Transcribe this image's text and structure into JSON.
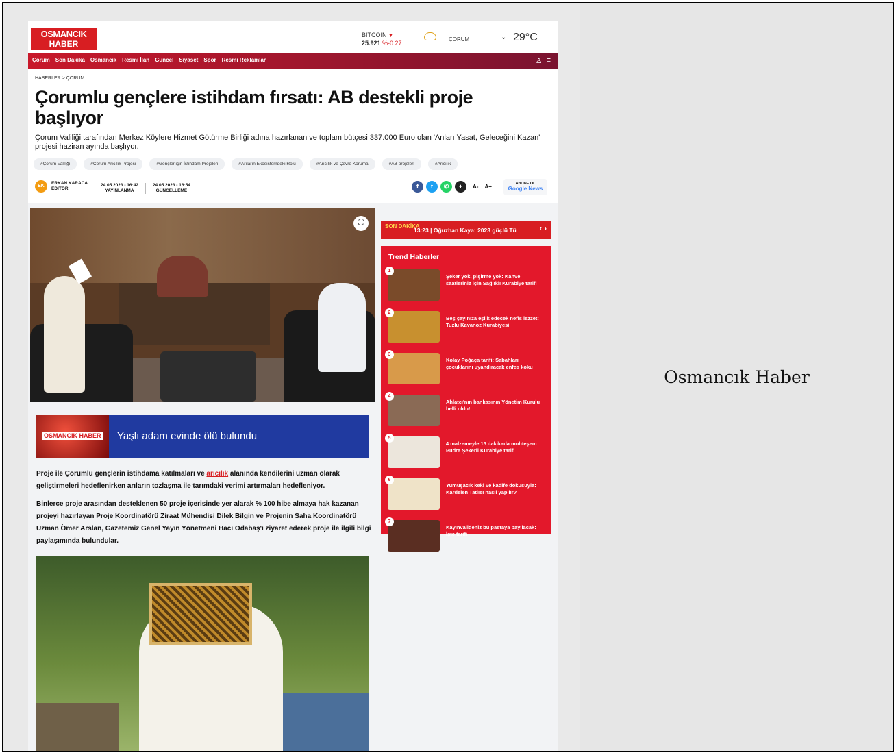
{
  "caption": "Osmancık Haber",
  "site": {
    "logo_line1": "OSMANCIK",
    "logo_line2": "HABER",
    "ticker_name": "BITCOIN",
    "ticker_value": "25.921",
    "ticker_change": "%-0.27",
    "weather_city": "ÇORUM",
    "weather_temp": "29°C"
  },
  "nav": {
    "items": [
      "Çorum",
      "Son Dakika",
      "Osmancık",
      "Resmi İlan",
      "Güncel",
      "Siyaset",
      "Spor",
      "Resmi Reklamlar"
    ]
  },
  "article": {
    "breadcrumb": "HABERLER > ÇORUM",
    "title": "Çorumlu gençlere istihdam fırsatı: AB destekli proje başlıyor",
    "summary": "Çorum Valiliği tarafından Merkez Köylere Hizmet Götürme Birliği adına hazırlanan ve toplam bütçesi 337.000 Euro olan 'Anları Yasat, Geleceğini Kazan' projesi haziran ayında başlıyor.",
    "tags": [
      "#Çorum Valiliği",
      "#Çorum Arıcılık Projesi",
      "#Gençler için İstihdam Projeleri",
      "#Arıların Ekosistemdeki Rolü",
      "#Arıcılık ve Çevre Koruma",
      "#AB projeleri",
      "#Arıcılık"
    ],
    "author_initials": "EK",
    "author_name": "ERKAN KARACA",
    "author_role": "EDİTÖR",
    "published": "24.05.2023 - 16:42",
    "published_label": "YAYINLANMA",
    "updated": "24.05.2023 - 16:54",
    "updated_label": "GÜNCELLEME",
    "font_small": "A-",
    "font_large": "A+",
    "gnews_line1": "ABONE OL",
    "gnews_line2": "Google News",
    "banner_logo": "OSMANCIK HABER",
    "banner_text": "Yaşlı adam evinde ölü bulundu",
    "p1_before": "Proje ile Çorumlu gençlerin istihdama katılmaları ve ",
    "p1_link": "arıcılık",
    "p1_after": " alanında kendilerini uzman olarak geliştirmeleri hedeflenirken arıların tozlaşma ile tarımdaki verimi artırmaları hedefleniyor.",
    "p2": "Binlerce proje arasından desteklenen 50 proje içerisinde yer alarak % 100 hibe almaya hak kazanan projeyi hazırlayan Proje Koordinatörü Ziraat Mühendisi Dilek Bilgin ve Projenin Saha Koordinatörü Uzman Ömer Arslan, Gazetemiz Genel Yayın Yönetmeni Hacı Odabaş'ı ziyaret ederek proje ile ilgili bilgi paylaşımında bulundular."
  },
  "breaking": {
    "label": "SON DAKİKA",
    "text": "13:23 | Oğuzhan Kaya: 2023 güçlü Tü"
  },
  "trend": {
    "title": "Trend Haberler",
    "items": [
      {
        "num": "1",
        "text": "Şeker yok, pişirme yok: Kahve saatleriniz için Sağlıklı Kurabiye tarifi",
        "color": "#7a4b2a"
      },
      {
        "num": "2",
        "text": "Beş çayınıza eşlik edecek nefis lezzet: Tuzlu Kavanoz Kurabiyesi",
        "color": "#c8902f"
      },
      {
        "num": "3",
        "text": "Kolay Poğaça tarifi: Sabahları çocuklarını uyandıracak enfes koku",
        "color": "#d89a4a"
      },
      {
        "num": "4",
        "text": "Ahlatcı'nın bankasının Yönetim Kurulu belli oldu!",
        "color": "#8a6a55"
      },
      {
        "num": "5",
        "text": "4 malzemeyle 15 dakikada muhteşem Pudra Şekerli Kurabiye tarifi",
        "color": "#ece6dc"
      },
      {
        "num": "6",
        "text": "Yumuşacık keki ve kadife dokusuyla: Kardelen Tatlısı nasıl yapılır?",
        "color": "#efe3c8"
      },
      {
        "num": "7",
        "text": "Kayınvalideniz bu pastaya bayılacak: İşte tarifi",
        "color": "#5a2e22"
      }
    ]
  },
  "colors": {
    "brand_red": "#d81e22",
    "banner_blue": "#203aa0",
    "facebook": "#3b5998",
    "twitter": "#1da1f2",
    "whatsapp": "#25d366",
    "more": "#222222"
  }
}
